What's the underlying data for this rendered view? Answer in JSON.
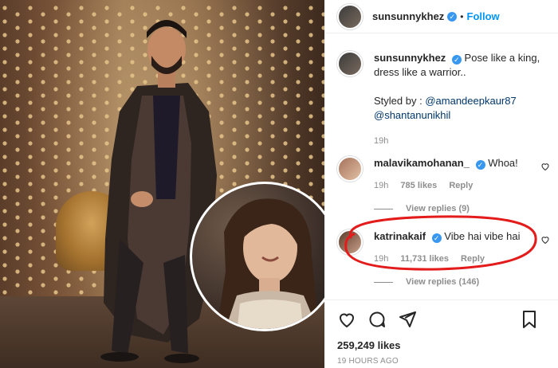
{
  "post": {
    "author": "sunsunnykhez",
    "follow_label": "Follow",
    "dot": "•",
    "caption_text": "Pose like a king, dress like a warrior..",
    "styled_by_prefix": "Styled by :",
    "mention_1": "@amandeepkaur87",
    "mention_2": "@shantanunikhil",
    "caption_time": "19h",
    "likes": "259,249 likes",
    "posted_ago": "19 HOURS AGO"
  },
  "comments": [
    {
      "user": "malavikamohanan_",
      "text": "Whoa!",
      "time": "19h",
      "likes": "785 likes",
      "reply_label": "Reply",
      "view_replies": "View replies (9)"
    },
    {
      "user": "katrinakaif",
      "text": "Vibe hai vibe hai",
      "time": "19h",
      "likes": "11,731 likes",
      "reply_label": "Reply",
      "view_replies": "View replies (146)"
    }
  ],
  "colors": {
    "accent_blue": "#0095f6",
    "verified_blue": "#3897f0",
    "annotation_red": "#e31b1b"
  },
  "icons": {
    "verified": "verified-badge-icon",
    "heart": "heart-icon",
    "comment": "comment-icon",
    "share": "share-icon",
    "save": "bookmark-icon"
  }
}
